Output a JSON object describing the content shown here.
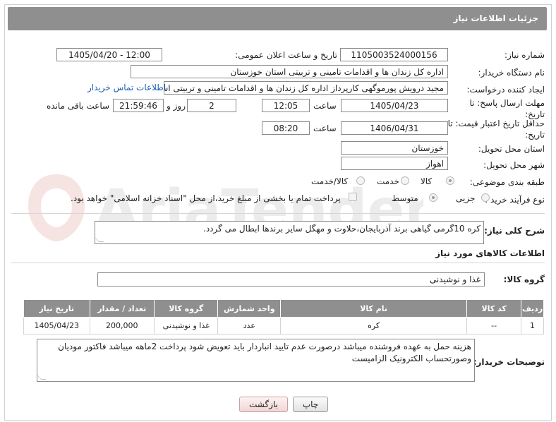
{
  "header": {
    "title": "جزئیات اطلاعات نیاز"
  },
  "labels": {
    "need_number": "شماره نیاز:",
    "announce_datetime": "تاریخ و ساعت اعلان عمومی:",
    "buyer_org": "نام دستگاه خریدار:",
    "requester": "ایجاد کننده درخواست:",
    "reply_deadline": "مهلت ارسال پاسخ: تا تاریخ:",
    "time_word": "ساعت",
    "day_and": "روز و",
    "remaining": "ساعت باقی مانده",
    "price_validity": "حداقل تاریخ اعتبار قیمت: تا تاریخ:",
    "province": "استان محل تحویل:",
    "city": "شهر محل تحویل:",
    "category": "طبقه بندی موضوعی:",
    "process_type": "نوع فرآیند خرید :",
    "general_desc": "شرح کلی نیاز:",
    "goods_info": "اطلاعات کالاهای مورد نیاز",
    "goods_group": "گروه کالا:",
    "buyer_notes": "توضیحات خریدار:"
  },
  "values": {
    "need_number": "1105003524000156",
    "announce_datetime": "1405/04/20 - 12:00",
    "buyer_org": "اداره کل زندان ها و اقدامات تامینی و تربیتی استان خوزستان",
    "requester": "مجید درویش پورموگهی کارپرداز اداره کل زندان ها و اقدامات تامینی و تربیتی است",
    "contact_link": "اطلاعات تماس خریدار",
    "reply_date": "1405/04/23",
    "reply_time": "12:05",
    "days": "2",
    "remaining_time": "21:59:46",
    "price_date": "1406/04/31",
    "price_time": "08:20",
    "province": "خوزستان",
    "city": "اهواز",
    "general_desc": "کره 10گرمی گیاهی برند آذربایجان،حلاوت و مهگل سایر برندها ابطال می گردد.",
    "goods_group": "غذا و نوشیدنی",
    "buyer_notes": "هزینه حمل به عهده فروشنده میباشد درصورت عدم تایید انباردار باید تعویض شود پرداخت 2ماهه میباشد فاکتور مودیان وصورتحساب الکترونیک الزامیست"
  },
  "category_options": [
    "کالا",
    "خدمت",
    "کالا/خدمت"
  ],
  "category_selected": "کالا",
  "process_options": [
    "جزیی",
    "متوسط"
  ],
  "process_selected": "متوسط",
  "payment_note": "پرداخت تمام یا بخشی از مبلغ خرید،از محل \"اسناد خزانه اسلامی\" خواهد بود.",
  "table": {
    "headers": [
      "ردیف",
      "کد کالا",
      "نام کالا",
      "واحد شمارش",
      "گروه کالا",
      "تعداد / مقدار",
      "تاریخ نیاز"
    ],
    "rows": [
      [
        "1",
        "--",
        "کره",
        "عدد",
        "غذا و نوشیدنی",
        "200,000",
        "1405/04/23"
      ]
    ]
  },
  "buttons": {
    "print": "چاپ",
    "back": "بازگشت"
  },
  "watermark": {
    "text": "AriaTender.net"
  }
}
